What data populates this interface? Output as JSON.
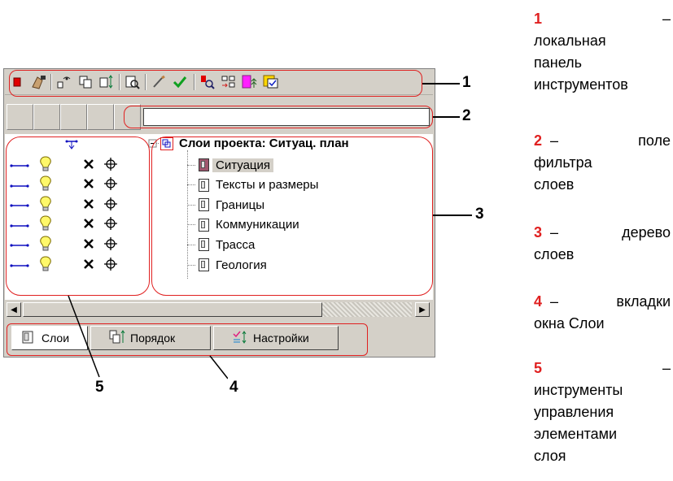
{
  "toolbar": {
    "buttons": [
      "red-square-icon",
      "pointer-hand-icon",
      "layer-eye-icon",
      "copy-layers-icon",
      "layer-arrows-icon",
      "zoom-layer-icon",
      "brush-icon",
      "check-icon",
      "red-zoom-icon",
      "grid-arrows-icon",
      "magenta-tree-icon",
      "yellow-check-icon"
    ]
  },
  "filter": {
    "value": "",
    "placeholder": ""
  },
  "tree": {
    "root_label": "Слои проекта: Ситуац. план",
    "items": [
      {
        "label": "Ситуация",
        "selected": true
      },
      {
        "label": "Тексты и размеры",
        "selected": false
      },
      {
        "label": "Границы",
        "selected": false
      },
      {
        "label": "Коммуникации",
        "selected": false
      },
      {
        "label": "Трасса",
        "selected": false
      },
      {
        "label": "Геология",
        "selected": false
      }
    ]
  },
  "tabs": [
    {
      "label": "Слои",
      "active": true
    },
    {
      "label": "Порядок",
      "active": false
    },
    {
      "label": "Настройки",
      "active": false
    }
  ],
  "callouts": [
    "1",
    "2",
    "3",
    "4",
    "5"
  ],
  "legend": [
    {
      "num": "1",
      "dash": "–",
      "text": [
        "локальная",
        "панель",
        "инструментов"
      ]
    },
    {
      "num": "2",
      "dash": "–",
      "text": [
        "поле",
        "фильтра",
        "слоев"
      ]
    },
    {
      "num": "3",
      "dash": "–",
      "text": [
        "дерево",
        "слоев"
      ]
    },
    {
      "num": "4",
      "dash": "–",
      "text": [
        "вкладки",
        "окна Слои"
      ]
    },
    {
      "num": "5",
      "dash": "–",
      "text": [
        "инструменты",
        "управления",
        "элементами",
        "слоя"
      ]
    }
  ],
  "colors": {
    "annotation": "#e02020",
    "accent_number": "#e02020"
  }
}
